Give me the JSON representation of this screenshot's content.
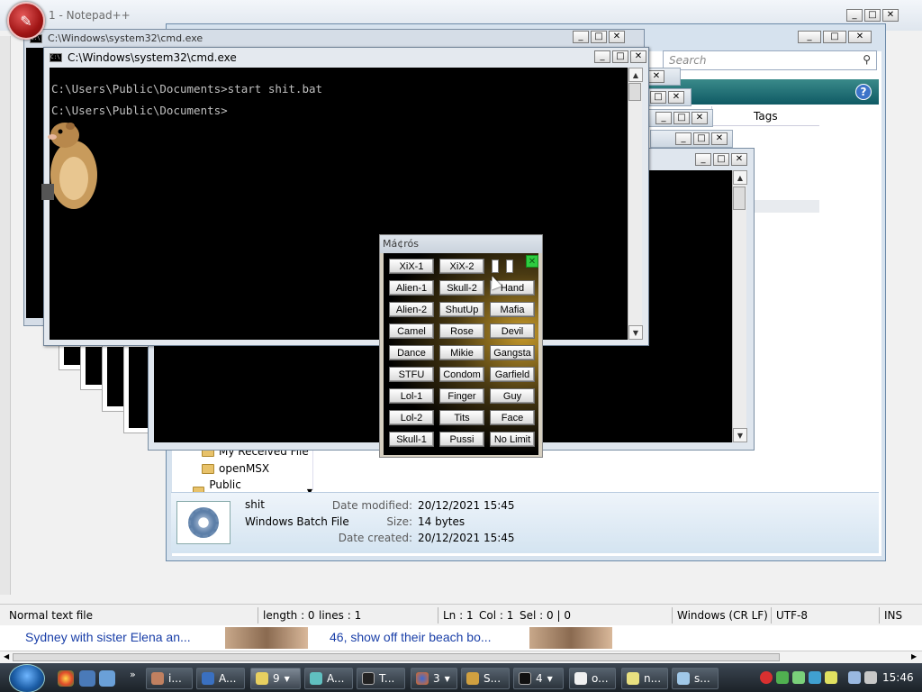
{
  "notepad": {
    "title": "1 - Notepad++",
    "status": {
      "file_type": "Normal text file",
      "length": "length : 0",
      "lines": "lines : 1",
      "ln": "Ln : 1",
      "col": "Col : 1",
      "sel": "Sel : 0 | 0",
      "eol": "Windows (CR LF)",
      "encoding": "UTF-8",
      "mode": "INS"
    }
  },
  "explorer": {
    "search_placeholder": "Search",
    "tags_column": "Tags",
    "nav_items": [
      "My Received File",
      "openMSX",
      "Public Downloads"
    ],
    "details": {
      "name": "shit",
      "type": "Windows Batch File",
      "modified_label": "Date modified:",
      "modified_value": "20/12/2021 15:45",
      "size_label": "Size:",
      "size_value": "14 bytes",
      "created_label": "Date created:",
      "created_value": "20/12/2021 15:45"
    }
  },
  "cmd_back": {
    "title": "C:\\Windows\\system32\\cmd.exe"
  },
  "cmd_main": {
    "title": "C:\\Windows\\system32\\cmd.exe",
    "lines": [
      "C:\\Users\\Public\\Documents>start shit.bat",
      "C:\\Users\\Public\\Documents>"
    ]
  },
  "macros": {
    "title": "Má¢rós",
    "buttons": [
      "XiX-1",
      "XiX-2",
      "Alien-1",
      "Skull-2",
      "Hand",
      "Alien-2",
      "ShutUp",
      "Mafia",
      "Camel",
      "Rose",
      "Devil",
      "Dance",
      "Mikie",
      "Gangsta",
      "STFU",
      "Condom",
      "Garfield",
      "Lol-1",
      "Finger",
      "Guy",
      "Lol-2",
      "Tits",
      "Face",
      "Skull-1",
      "Pussi",
      "No Limit"
    ]
  },
  "web": {
    "link1": "Sydney with sister Elena an...",
    "link2": "46, show off their beach bo..."
  },
  "taskbar": {
    "items": [
      "i...",
      "A...",
      "9",
      "A...",
      "T...",
      "3",
      "S...",
      "4",
      "o...",
      "n...",
      "s..."
    ],
    "clock": "15:46"
  }
}
